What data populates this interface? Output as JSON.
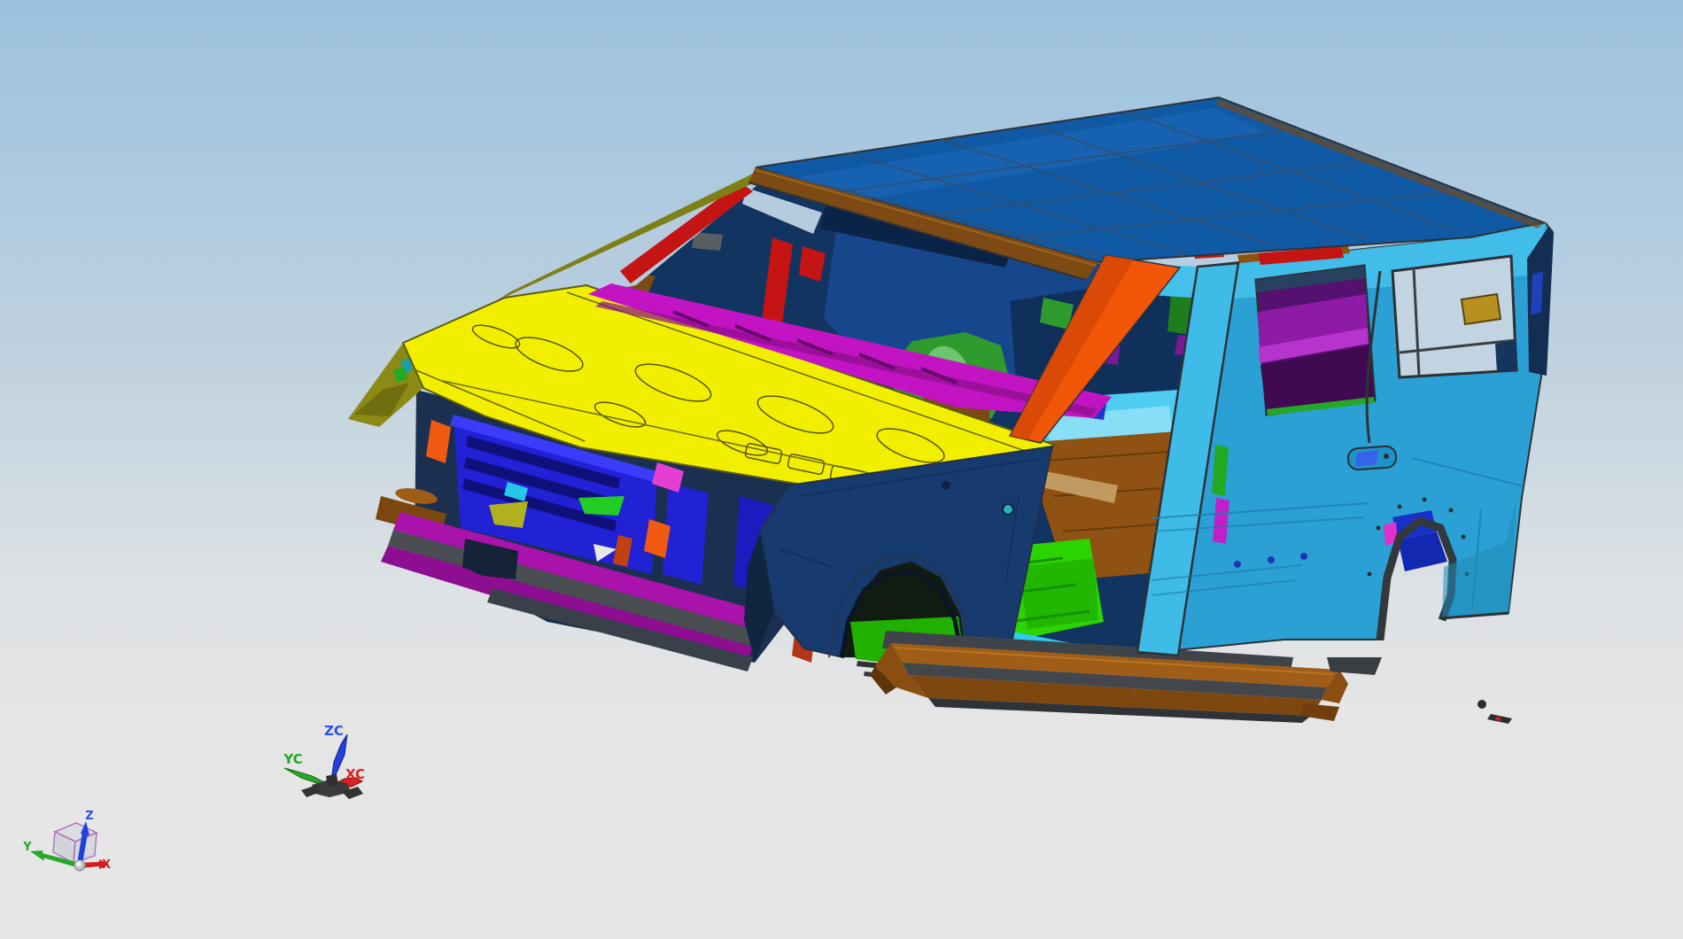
{
  "viewport": {
    "type": "3d-cad-viewport",
    "background_top": "#9dc1de",
    "background_bottom": "#e6e6e6"
  },
  "model": {
    "name": "suv-body-in-white",
    "colors": {
      "roof": "#1059a4",
      "roof_grid": "#2e4f74",
      "header_brown": "#7c4a12",
      "a_pillar_orange": "#f25708",
      "accent_red": "#c51414",
      "body_cyan": "#2aa0d4",
      "body_cyan_light": "#45c0ec",
      "b_pillar_cyan": "#3fbbe8",
      "cowl_yellow": "#f2ee00",
      "fender_navy": "#173b6e",
      "fender_olive": "#8a8a14",
      "radiator_blue": "#2121d6",
      "bumper_magenta": "#a912ab",
      "cowl_vent_magenta": "#c214c2",
      "rocker_brown": "#a05d17",
      "floor_green": "#2bd400",
      "floor_brown": "#8f5212",
      "floor_cyan": "#4ecdf0",
      "sill_cyan": "#2bcdea",
      "seat_green": "#2f9b2f",
      "quarter_trim_purple": "#8e1ba6",
      "interior_navy": "#123460",
      "dash_blue": "#16468c",
      "wheelhouse_blue": "#1832c8",
      "edge_gray": "#33383c"
    }
  },
  "wcs_triad": {
    "z_label": "ZC",
    "y_label": "YC",
    "x_label": "XC",
    "z_color": "#2a50f0",
    "y_color": "#22a822",
    "x_color": "#e02020"
  },
  "view_triad": {
    "z_label": "Z",
    "y_label": "Y",
    "x_label": "X",
    "z_color": "#2a50f0",
    "y_color": "#22a822",
    "x_color": "#d02020"
  }
}
